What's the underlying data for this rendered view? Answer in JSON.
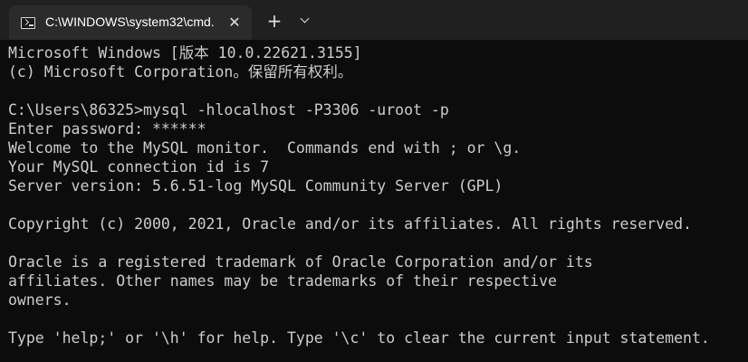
{
  "tab": {
    "title": "C:\\WINDOWS\\system32\\cmd.",
    "close_glyph": "✕",
    "icon": "terminal-icon"
  },
  "titlebar": {
    "new_tab_glyph": "+",
    "dropdown_icon": "chevron-down-icon"
  },
  "terminal": {
    "lines": [
      "Microsoft Windows [版本 10.0.22621.3155]",
      "(c) Microsoft Corporation。保留所有权利。",
      "",
      "C:\\Users\\86325>mysql -hlocalhost -P3306 -uroot -p",
      "Enter password: ******",
      "Welcome to the MySQL monitor.  Commands end with ; or \\g.",
      "Your MySQL connection id is 7",
      "Server version: 5.6.51-log MySQL Community Server (GPL)",
      "",
      "Copyright (c) 2000, 2021, Oracle and/or its affiliates. All rights reserved.",
      "",
      "Oracle is a registered trademark of Oracle Corporation and/or its",
      "affiliates. Other names may be trademarks of their respective",
      "owners.",
      "",
      "Type 'help;' or '\\h' for help. Type '\\c' to clear the current input statement."
    ]
  },
  "colors": {
    "background": "#0c0c0c",
    "titlebar": "#202020",
    "active_tab": "#2b2b2b",
    "text": "#cccccc"
  }
}
